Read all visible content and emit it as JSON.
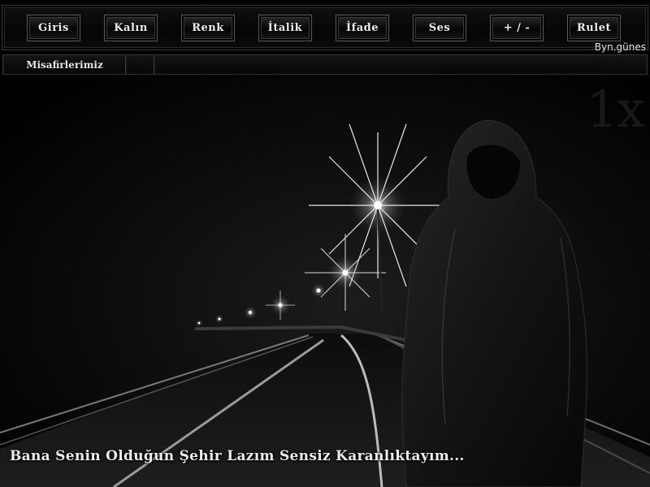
{
  "toolbar": {
    "buttons": [
      {
        "label": "Giris"
      },
      {
        "label": "Kalın"
      },
      {
        "label": "Renk"
      },
      {
        "label": "İtalik"
      },
      {
        "label": "İfade"
      },
      {
        "label": "Ses"
      },
      {
        "label": "+ / -"
      },
      {
        "label": "Rulet"
      }
    ],
    "credit": "Byn.günes"
  },
  "subbar": {
    "guests_label": "Misafirlerimiz",
    "cell2": "",
    "cell3": ""
  },
  "scene": {
    "watermark": "1x",
    "caption": "Bana Senin Olduğun Şehir Lazım Sensiz Karanlıktayım..."
  }
}
